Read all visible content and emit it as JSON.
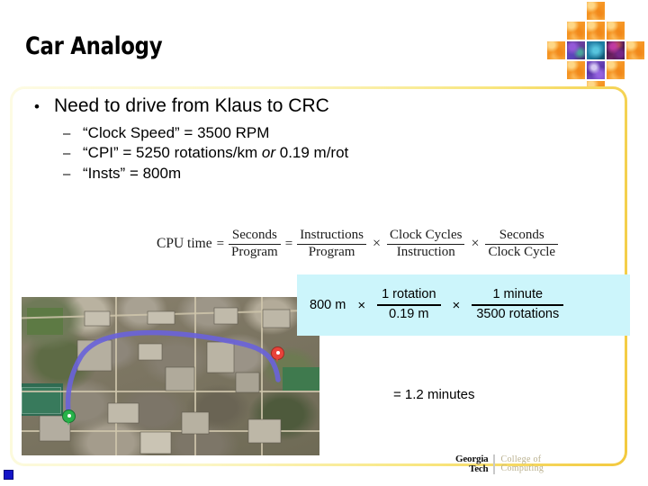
{
  "slide": {
    "title": "Car Analogy",
    "bullets": [
      {
        "marker": "•",
        "text": "Need to drive from Klaus to CRC",
        "level": 1
      }
    ],
    "sub_bullets": [
      {
        "marker": "–",
        "text": "“Clock Speed” = 3500 RPM"
      },
      {
        "marker": "–",
        "text_a": "“CPI” = 5250 rotations/km ",
        "text_it": "or",
        "text_b": " 0.19 m/rot"
      },
      {
        "marker": "–",
        "text": "“Insts” =  800m"
      }
    ]
  },
  "cpu_formula": {
    "label": "CPU time",
    "eq1": "=",
    "f1_num": "Seconds",
    "f1_den": "Program",
    "eq2": "=",
    "f2_num": "Instructions",
    "f2_den": "Program",
    "mul1": "×",
    "f3_num": "Clock Cycles",
    "f3_den": "Instruction",
    "mul2": "×",
    "f4_num": "Seconds",
    "f4_den": "Clock Cycle"
  },
  "unit_box": {
    "background_color": "#ccf5fb",
    "quantity": "800 m",
    "mul1": "×",
    "f1_num": "1 rotation",
    "f1_den": "0.19 m",
    "mul2": "×",
    "f2_num": "1 minute",
    "f2_den": "3500 rotations"
  },
  "result": "= 1.2 minutes",
  "logo": {
    "line1": "Georgia",
    "line2": "Tech",
    "coc_line1": "College of",
    "coc_line2": "Computing"
  },
  "map": {
    "alt": "satellite map of Georgia Tech campus with driving route from Klaus to CRC",
    "start_marker": "green-start-pin",
    "end_marker": "red-destination-pin",
    "route_color": "#6a63d8"
  },
  "decor": {
    "accent_orange": "#f59220",
    "frame_color": "#f7f3b8",
    "tiles": [
      {
        "row": 0,
        "col": 2,
        "kind": "orange"
      },
      {
        "row": 1,
        "col": 1,
        "kind": "orange"
      },
      {
        "row": 1,
        "col": 2,
        "kind": "orange"
      },
      {
        "row": 1,
        "col": 3,
        "kind": "orange"
      },
      {
        "row": 2,
        "col": 0,
        "kind": "orange"
      },
      {
        "row": 2,
        "col": 1,
        "kind": "t-purple"
      },
      {
        "row": 2,
        "col": 2,
        "kind": "t-teal"
      },
      {
        "row": 2,
        "col": 3,
        "kind": "t-magenta"
      },
      {
        "row": 2,
        "col": 4,
        "kind": "orange"
      },
      {
        "row": 3,
        "col": 1,
        "kind": "orange"
      },
      {
        "row": 3,
        "col": 2,
        "kind": "t-violet"
      },
      {
        "row": 3,
        "col": 3,
        "kind": "orange"
      },
      {
        "row": 4,
        "col": 2,
        "kind": "orange"
      }
    ]
  }
}
